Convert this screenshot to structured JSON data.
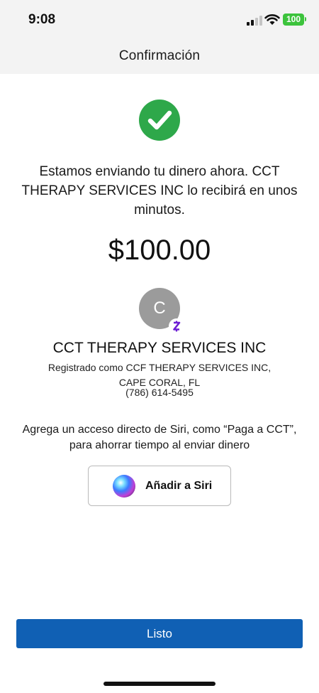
{
  "status_bar": {
    "time": "9:08",
    "battery": "100",
    "battery_color": "#3cc33c"
  },
  "header": {
    "title": "Confirmación"
  },
  "confirmation": {
    "icon": "checkmark-icon",
    "success_color": "#2ea84a",
    "message": "Estamos enviando tu dinero ahora. CCT THERAPY SERVICES INC lo recibirá en unos minutos.",
    "amount": "$100.00"
  },
  "recipient": {
    "avatar_initial": "C",
    "badge": "Z",
    "name": "CCT THERAPY SERVICES INC",
    "registered_as": "Registrado como CCF THERAPY SERVICES INC, CAPE CORAL, FL",
    "phone": "(786) 614-5495"
  },
  "siri": {
    "prompt": "Agrega un acceso directo de Siri, como “Paga a CCT”, para ahorrar tiempo al enviar dinero",
    "button_label": "Añadir a Siri"
  },
  "footer": {
    "done_label": "Listo",
    "primary_color": "#1060b4"
  }
}
